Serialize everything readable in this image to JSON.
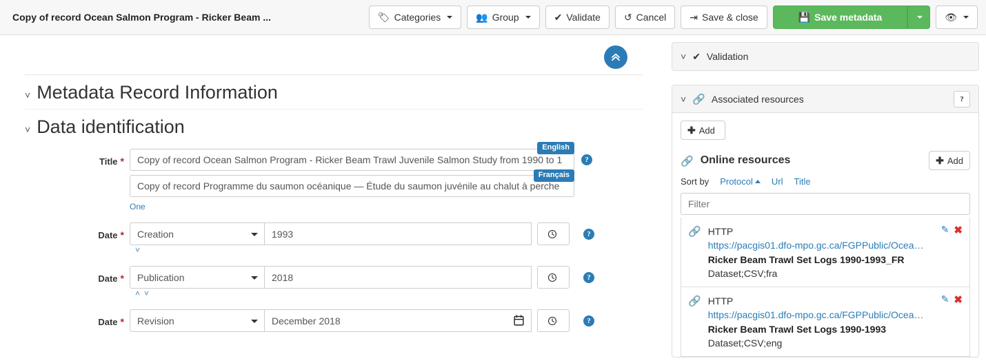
{
  "topbar": {
    "record_title": "Copy of record Ocean Salmon Program - Ricker Beam ...",
    "buttons": {
      "categories": "Categories",
      "group": "Group",
      "validate": "Validate",
      "cancel": "Cancel",
      "save_close": "Save & close",
      "save_metadata": "Save metadata"
    }
  },
  "main": {
    "sections": [
      {
        "title": "Metadata Record Information"
      },
      {
        "title": "Data identification"
      }
    ],
    "title_field": {
      "label": "Date",
      "field_label": "Title",
      "english_badge": "English",
      "french_badge": "Français",
      "english_value": "Copy of record Ocean Salmon Program - Ricker Beam Trawl Juvenile Salmon Study from 1990 to 1",
      "french_value": "Copy of record Programme du saumon océanique — Étude du saumon juvénile au chalut à perche",
      "cardinality_link": "One"
    },
    "dates": [
      {
        "label": "Date",
        "type": "Creation",
        "value": "1993",
        "has_picker": false
      },
      {
        "label": "Date",
        "type": "Publication",
        "value": "2018",
        "has_picker": false
      },
      {
        "label": "Date",
        "type": "Revision",
        "value": "December 2018",
        "has_picker": true
      }
    ]
  },
  "side": {
    "validation": {
      "title": "Validation"
    },
    "associated": {
      "title": "Associated resources",
      "add_label": "Add",
      "online_resources": {
        "title": "Online resources",
        "add_label": "Add",
        "sort_by_label": "Sort by",
        "sort_options": [
          "Protocol",
          "Url",
          "Title"
        ],
        "active_sort": "Protocol",
        "filter_placeholder": "Filter",
        "items": [
          {
            "protocol": "HTTP",
            "url": "https://pacgis01.dfo-mpo.gc.ca/FGPPublic/Ocea…",
            "name": "Ricker Beam Trawl Set Logs 1990-1993_FR",
            "meta": "Dataset;CSV;fra"
          },
          {
            "protocol": "HTTP",
            "url": "https://pacgis01.dfo-mpo.gc.ca/FGPPublic/Ocea…",
            "name": "Ricker Beam Trawl Set Logs 1990-1993",
            "meta": "Dataset;CSV;eng"
          }
        ]
      }
    }
  },
  "colors": {
    "accent_blue": "#2b7cb5",
    "success_green": "#5cb85c",
    "required_red": "#b0282d",
    "danger_red": "#d9302c"
  }
}
